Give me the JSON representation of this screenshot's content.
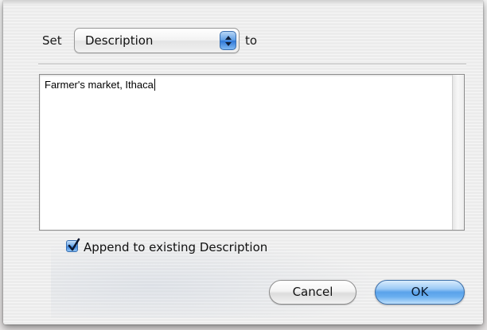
{
  "dialog": {
    "set_label": "Set",
    "field_select": {
      "selected": "Description"
    },
    "to_label": "to",
    "text_value": "Farmer's market, Ithaca",
    "append_checkbox": {
      "label": "Append to existing Description",
      "checked": true
    },
    "buttons": {
      "cancel": "Cancel",
      "ok": "OK"
    }
  },
  "colors": {
    "accent_blue": "#5aa2ea",
    "sheet_bg": "#ececec"
  },
  "icons": {
    "popup": "up-down-arrows-icon",
    "checkbox": "checkmark-icon"
  }
}
